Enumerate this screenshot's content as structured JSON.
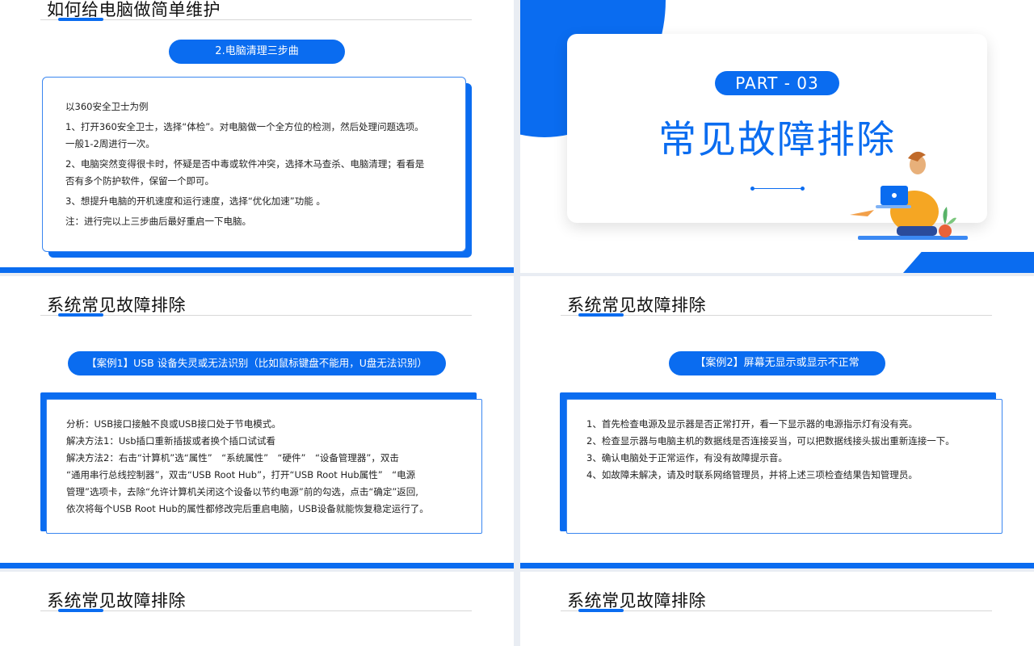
{
  "slide1": {
    "title": "如何给电脑做简单维护",
    "pill": "2.电脑清理三步曲",
    "lines": [
      "以360安全卫士为例",
      "1、打开360安全卫士，选择“体检”。对电脑做一个全方位的检测，然后处理问题选项。",
      "一般1-2周进行一次。",
      "2、电脑突然变得很卡时，怀疑是否中毒或软件冲突，选择木马查杀、电脑清理；看看是",
      "否有多个防护软件，保留一个即可。",
      "3、想提升电脑的开机速度和运行速度，选择“优化加速”功能 。",
      "注：进行完以上三步曲后最好重启一下电脑。"
    ]
  },
  "slide2": {
    "part": "PART - 03",
    "title": "常见故障排除",
    "colors": {
      "accent": "#0a6cf0"
    }
  },
  "slide3": {
    "title": "系统常见故障排除",
    "pill": "【案例1】USB 设备失灵或无法识别（比如鼠标键盘不能用，U盘无法识别）",
    "lines": [
      "分析：USB接口接触不良或USB接口处于节电模式。",
      "解决方法1：Usb插口重新插拔或者换个插口试试看",
      "解决方法2：右击“计算机”选“属性”　“系统属性”　“硬件”　“设备管理器”，双击",
      "“通用串行总线控制器”，双击“USB Root Hub”，打开“USB Root Hub属性”　“电源",
      "管理”选项卡，去除“允许计算机关闭这个设备以节约电源”前的勾选，点击“确定”返回,",
      "依次将每个USB Root Hub的属性都修改完后重启电脑，USB设备就能恢复稳定运行了。"
    ]
  },
  "slide4": {
    "title": "系统常见故障排除",
    "pill": "【案例2】屏幕无显示或显示不正常",
    "lines": [
      "1、首先检查电源及显示器是否正常打开，看一下显示器的电源指示灯有没有亮。",
      "2、检查显示器与电脑主机的数据线是否连接妥当，可以把数据线接头拔出重新连接一下。",
      "3、确认电脑处于正常运作，有没有故障提示音。",
      "4、如故障未解决，请及时联系网络管理员，并将上述三项检查结果告知管理员。"
    ]
  },
  "slide5": {
    "title": "系统常见故障排除"
  },
  "slide6": {
    "title": "系统常见故障排除"
  }
}
